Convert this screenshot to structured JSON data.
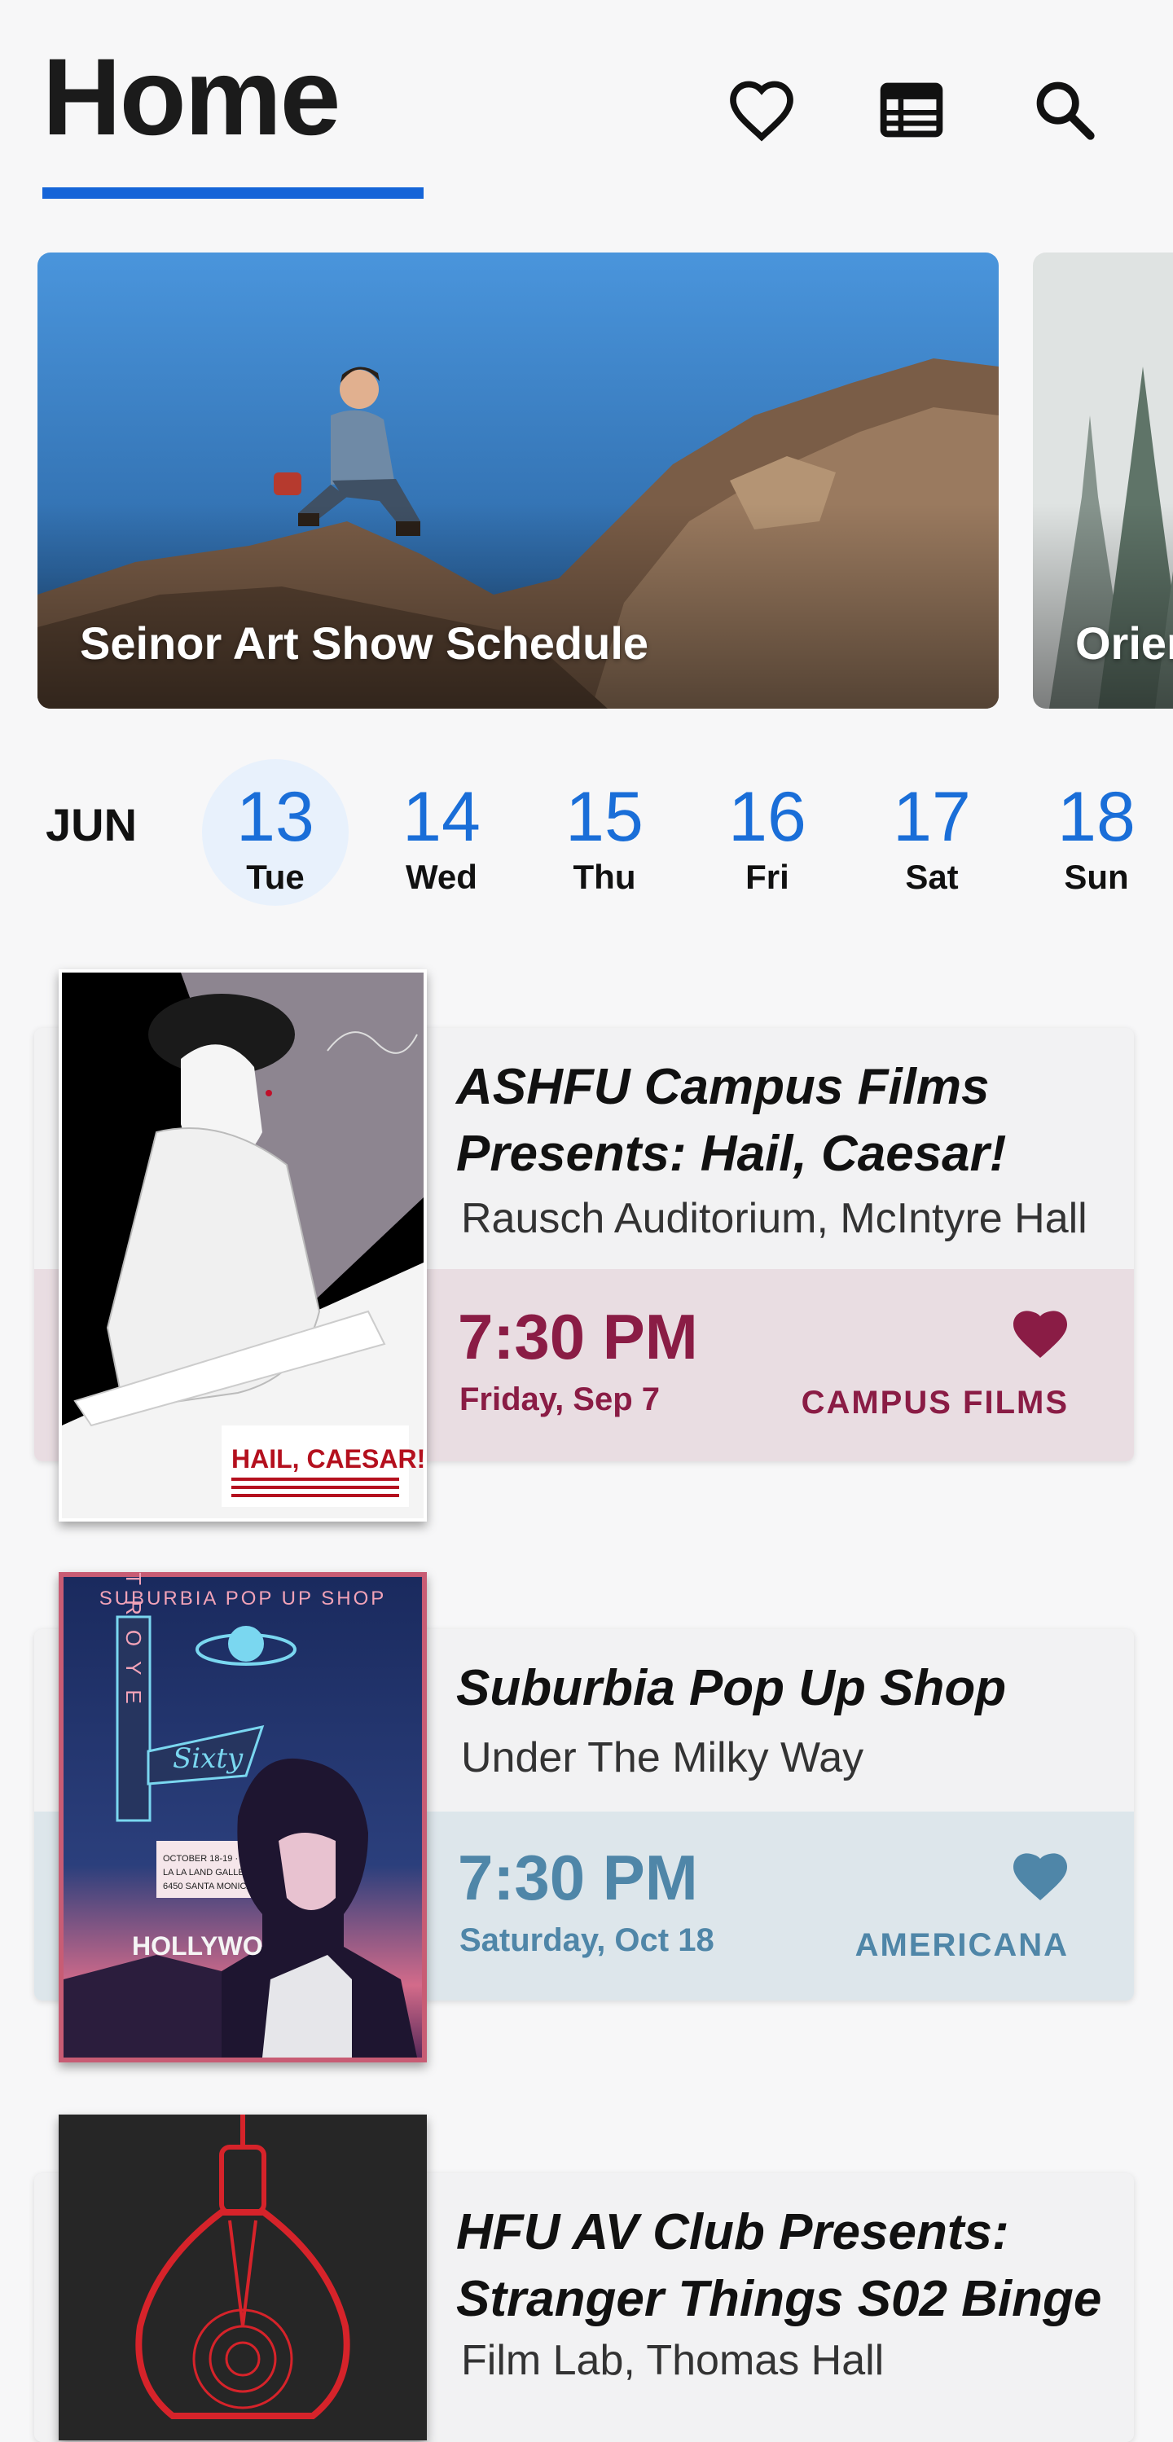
{
  "header": {
    "title": "Home",
    "icons": [
      "heart-icon",
      "calendar-icon",
      "search-icon"
    ]
  },
  "featured": [
    {
      "title": "Seinor Art Show Schedule"
    },
    {
      "title": "Orien"
    }
  ],
  "dates": {
    "month": "JUN",
    "days": [
      {
        "num": "13",
        "dow": "Tue",
        "selected": true
      },
      {
        "num": "14",
        "dow": "Wed"
      },
      {
        "num": "15",
        "dow": "Thu"
      },
      {
        "num": "16",
        "dow": "Fri"
      },
      {
        "num": "17",
        "dow": "Sat"
      },
      {
        "num": "18",
        "dow": "Sun"
      }
    ]
  },
  "events": [
    {
      "title_line1": "ASHFU Campus Films",
      "title_line2": "Presents: Hail, Caesar!",
      "venue": "Rausch Auditorium, McIntyre Hall",
      "time": "7:30 PM",
      "date": "Friday, Sep 7",
      "org": "CAMPUS FILMS",
      "accent": "#8a1c45",
      "band": "#e9dde2",
      "poster_text": "HAIL, CAESAR!"
    },
    {
      "title_line1": "Suburbia Pop Up Shop",
      "venue": "Under The Milky Way",
      "time": "7:30 PM",
      "date": "Saturday, Oct 18",
      "org": "AMERICANA",
      "accent": "#4f86a8",
      "band": "#dde6eb",
      "poster_header": "SUBURBIA POP UP SHOP",
      "poster_sign": "TROYE",
      "poster_script": "Sixty",
      "poster_hollywood": "HOLLYWO",
      "poster_info_line1": "OCTOBER 18-19 · 2018",
      "poster_info_line2": "LA LA LAND GALLERY",
      "poster_info_line3": "6450 SANTA MONICA BLVD"
    },
    {
      "title_line1": "HFU AV Club Presents:",
      "title_line2": "Stranger Things S02 Binge",
      "venue": "Film Lab, Thomas Hall"
    }
  ]
}
